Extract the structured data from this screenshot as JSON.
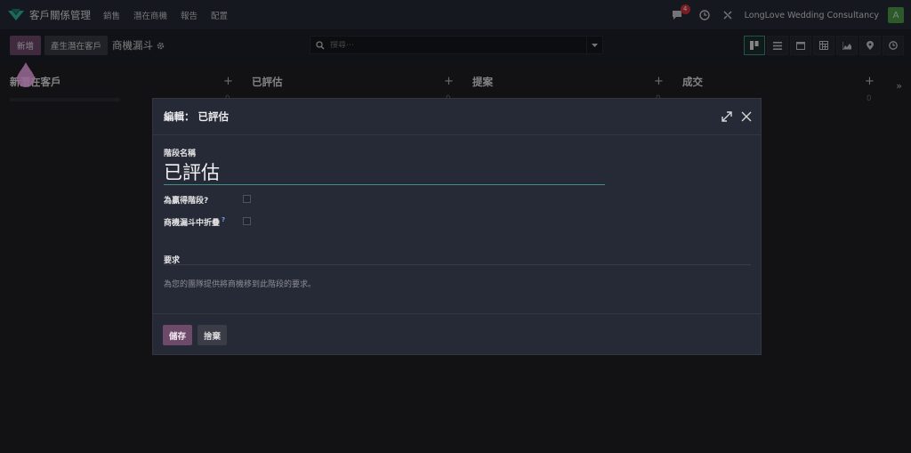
{
  "app": {
    "name": "客戶關係管理",
    "nav": [
      "銷售",
      "潛在商機",
      "報告",
      "配置"
    ],
    "messages_count": "4",
    "company": "LongLove Wedding Consultancy",
    "avatar_initial": "A"
  },
  "control_panel": {
    "new_label": "新增",
    "generate_leads_label": "產生潛在客戶",
    "breadcrumb": "商機漏斗",
    "search_placeholder": "搜尋⋯"
  },
  "kanban": {
    "columns": [
      {
        "name": "新潛在客戶",
        "count": "0"
      },
      {
        "name": "已評估",
        "count": "0"
      },
      {
        "name": "提案",
        "count": "0"
      },
      {
        "name": "成交",
        "count": "0"
      }
    ],
    "expand_label": "»"
  },
  "modal": {
    "title": "編輯： 已評估",
    "stage_name_label": "階段名稱",
    "stage_name_value": "已評估",
    "won_stage_label": "為贏得階段?",
    "folded_label": "商機漏斗中折疊",
    "help_mark": "?",
    "requirements_label": "要求",
    "requirements_placeholder": "為您的團隊提供將商機移到此階段的要求。",
    "save_label": "儲存",
    "discard_label": "捨棄"
  },
  "colors": {
    "primary": "#6d4a6a",
    "accent": "#3d8f86",
    "badge": "#d0333b",
    "logo_green": "#2fb59b"
  }
}
